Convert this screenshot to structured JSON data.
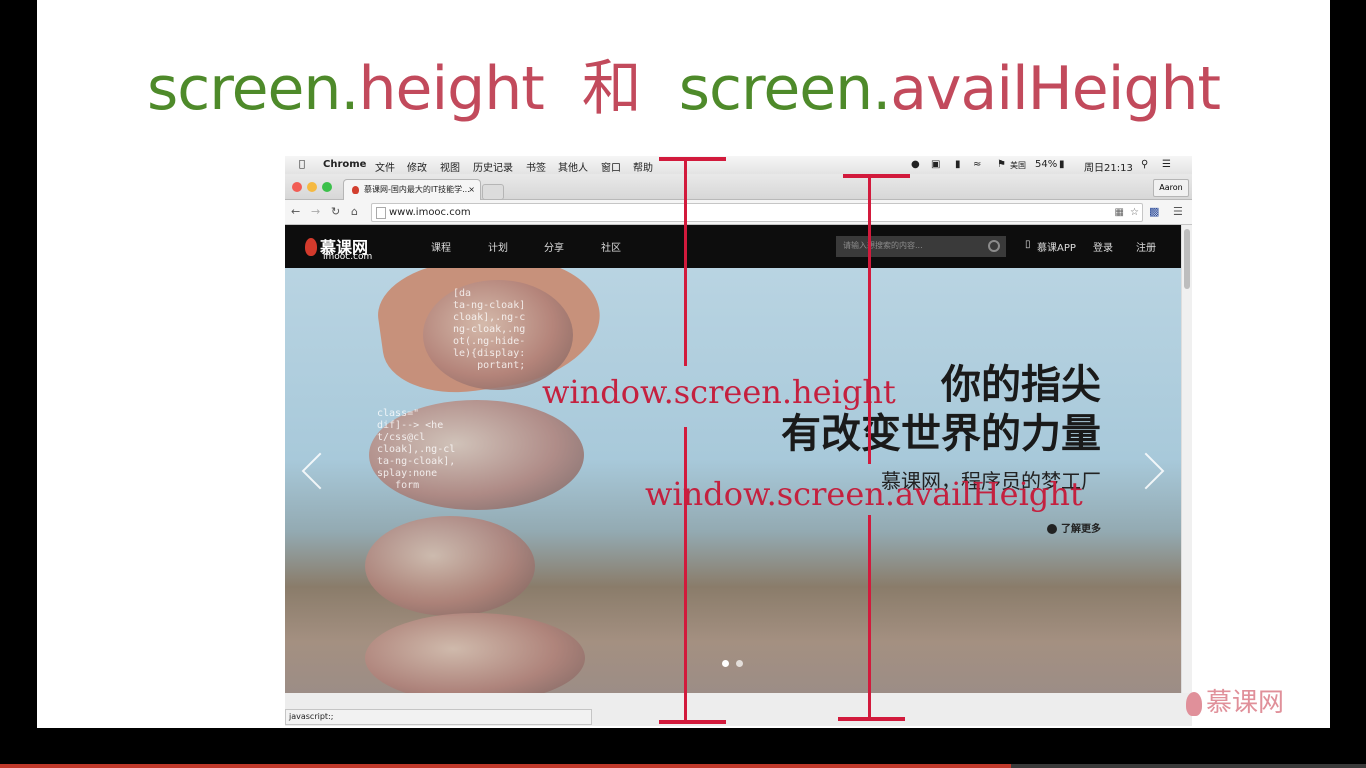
{
  "slide": {
    "title": {
      "part1": "screen.",
      "part2": "height",
      "connector": "和",
      "part3": "screen.",
      "part4": "availHeight"
    },
    "annotations": {
      "height": "window.screen.height",
      "avail_height": "window.screen.availHeight"
    },
    "brand": "慕课网",
    "colors": {
      "green": "#4e8a2a",
      "red": "#c24a5c",
      "annotation": "#d21a3c"
    }
  },
  "mac_menubar": {
    "items": [
      "Chrome",
      "文件",
      "修改",
      "视图",
      "历史记录",
      "书签",
      "其他人",
      "窗口",
      "帮助"
    ],
    "status": {
      "flag": "美国",
      "battery": "54%",
      "clock": "周日21:13"
    }
  },
  "browser": {
    "tab_title": "慕课网-国内最大的IT技能学...",
    "tab_close": "×",
    "profile": "Aaron",
    "url": "www.imooc.com",
    "status_text": "javascript:;"
  },
  "site": {
    "logo_cn": "慕课网",
    "logo_en": "imooc.com",
    "nav": [
      "课程",
      "计划",
      "分享",
      "社区"
    ],
    "search_placeholder": "请输入想搜索的内容...",
    "app": "慕课APP",
    "login": "登录",
    "register": "注册",
    "hero": {
      "headline1": "你的指尖",
      "headline2": "有改变世界的力量",
      "subline": "慕课网，程序员的梦工厂",
      "more": "了解更多"
    }
  },
  "video_progress": 0.74
}
